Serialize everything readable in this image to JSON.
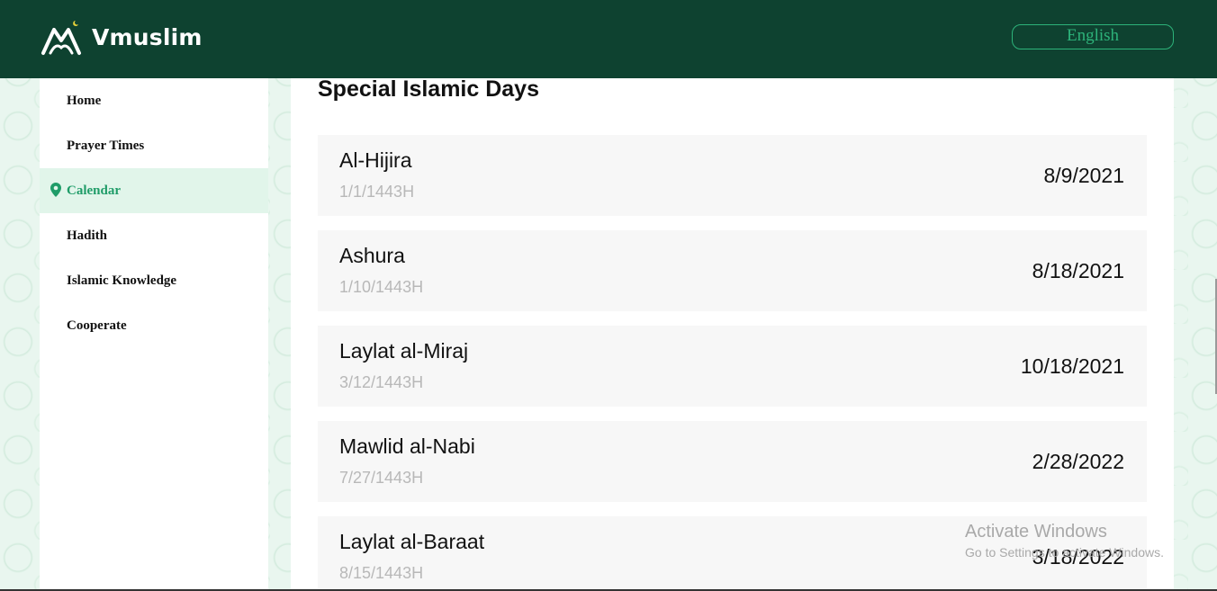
{
  "header": {
    "brand": "Vmuslim",
    "language_button": "English"
  },
  "sidebar": {
    "items": [
      {
        "label": "Home",
        "active": false
      },
      {
        "label": "Prayer Times",
        "active": false
      },
      {
        "label": "Calendar",
        "active": true,
        "icon": "location-pin-icon"
      },
      {
        "label": "Hadith",
        "active": false
      },
      {
        "label": "Islamic Knowledge",
        "active": false
      },
      {
        "label": "Cooperate",
        "active": false
      }
    ]
  },
  "main": {
    "title": "Special Islamic Days",
    "days": [
      {
        "name": "Al-Hijira",
        "hijri": "1/1/1443H",
        "date": "8/9/2021"
      },
      {
        "name": "Ashura",
        "hijri": "1/10/1443H",
        "date": "8/18/2021"
      },
      {
        "name": "Laylat al-Miraj",
        "hijri": "3/12/1443H",
        "date": "10/18/2021"
      },
      {
        "name": "Mawlid al-Nabi",
        "hijri": "7/27/1443H",
        "date": "2/28/2022"
      },
      {
        "name": "Laylat al-Baraat",
        "hijri": "8/15/1443H",
        "date": "3/18/2022"
      }
    ]
  },
  "watermark": {
    "title": "Activate Windows",
    "subtitle": "Go to Settings to activate Windows."
  },
  "colors": {
    "header_bg": "#0e4230",
    "accent": "#2db37a",
    "active_bg": "#e1f5ea",
    "active_text": "#1f9c68"
  }
}
